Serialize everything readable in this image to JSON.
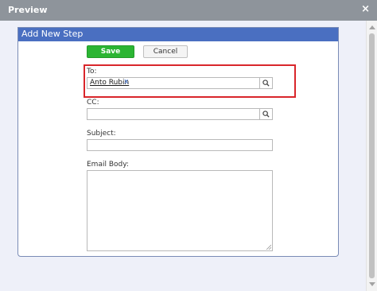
{
  "dialog": {
    "title": "Preview",
    "close_glyph": "×",
    "close_icon": "close-icon"
  },
  "panel": {
    "title": "Add New Step"
  },
  "actions": {
    "save_label": "Save",
    "cancel_label": "Cancel",
    "save_color": "#2bb533"
  },
  "form": {
    "to_label": "To:",
    "to_recipients": [
      {
        "name": "Anto Rubin",
        "remove_glyph": "x"
      }
    ],
    "cc_label": "CC:",
    "cc_value": "",
    "subject_label": "Subject:",
    "subject_value": "",
    "body_label": "Email Body:",
    "body_value": ""
  },
  "icons": {
    "search": "search-icon"
  },
  "colors": {
    "titlebar": "#8e949b",
    "panel_header": "#4a6fc1",
    "highlight": "#d9262b",
    "background": "#eef0f9"
  }
}
